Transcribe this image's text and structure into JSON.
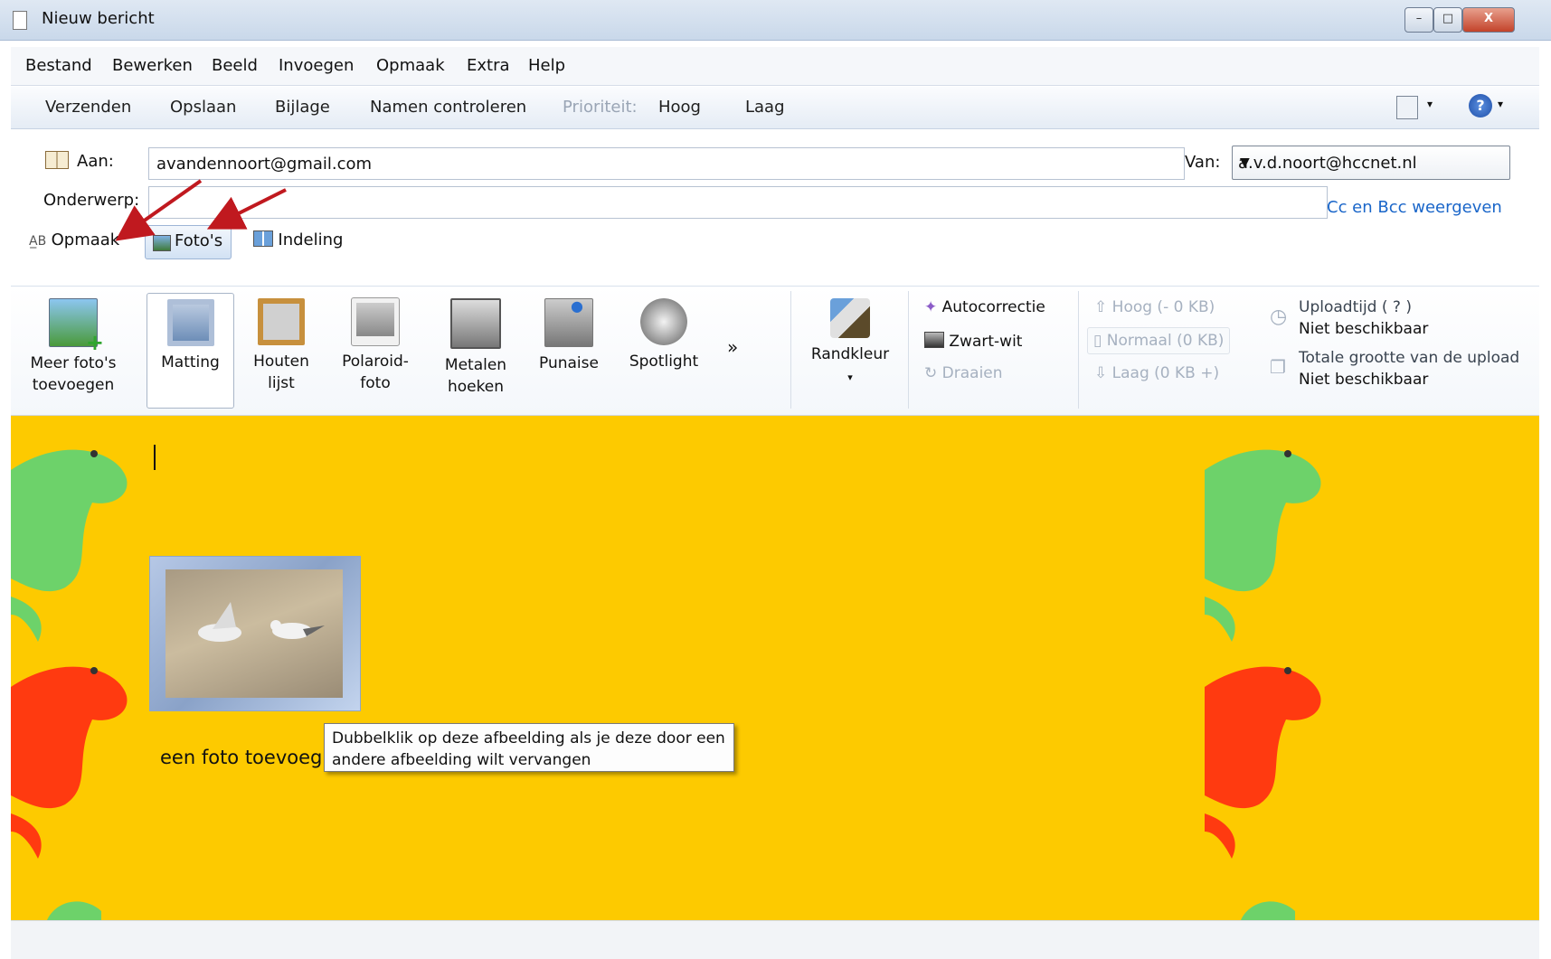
{
  "window": {
    "title": "Nieuw bericht",
    "controls": [
      "–",
      "□",
      "X"
    ]
  },
  "menu": [
    "Bestand",
    "Bewerken",
    "Beeld",
    "Invoegen",
    "Opmaak",
    "Extra",
    "Help"
  ],
  "toolbar": {
    "send": "Verzenden",
    "save": "Opslaan",
    "attach": "Bijlage",
    "check_names": "Namen controleren",
    "priority_label": "Prioriteit:",
    "priority_high": "Hoog",
    "priority_low": "Laag"
  },
  "compose": {
    "to_label": "Aan:",
    "to_value": "avandennoort@gmail.com",
    "subject_label": "Onderwerp:",
    "subject_value": "",
    "from_label": "Van:",
    "from_value": "a.v.d.noort@hccnet.nl",
    "cc_bcc_link": "Cc en Bcc weergeven"
  },
  "tabs": {
    "format": "Opmaak",
    "photos": "Foto's",
    "layout": "Indeling"
  },
  "ribbon": {
    "add_photos": "Meer foto's toevoegen",
    "styles": [
      "Matting",
      "Houten lijst",
      "Polaroid-foto",
      "Metalen hoeken",
      "Punaise",
      "Spotlight"
    ],
    "more": "»",
    "border_color": "Randkleur",
    "autocorrect": "Autocorrectie",
    "black_white": "Zwart-wit",
    "rotate": "Draaien",
    "size_high": "Hoog (- 0 KB)",
    "size_normal": "Normaal (0 KB)",
    "size_low": "Laag (0 KB +)",
    "upload_time_label": "Uploadtijd ( ? )",
    "upload_time_value": "Niet beschikbaar",
    "total_size_label": "Totale grootte van de upload",
    "total_size_value": "Niet beschikbaar"
  },
  "body": {
    "caption": "een foto toevoeg",
    "tooltip": "Dubbelklik op deze afbeelding als je deze door een andere afbeelding wilt vervangen"
  },
  "colors": {
    "background": "#fdca00",
    "dino_green": "#6dd26a",
    "dino_red": "#ff3a10",
    "link": "#1a66c9"
  }
}
